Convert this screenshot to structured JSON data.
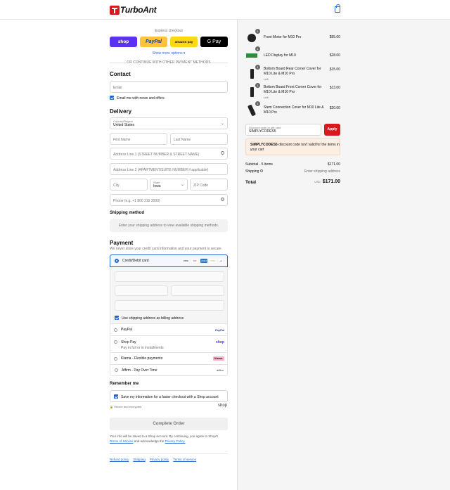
{
  "brand": {
    "name": "TurboAnt"
  },
  "express": {
    "title": "Express checkout",
    "buttons": [
      "shop",
      "PayPal",
      "amazon pay",
      "G Pay"
    ],
    "more": "Show more options",
    "divider": "OR CONTINUE WITH OTHER PAYMENT METHODS"
  },
  "contact": {
    "heading": "Contact",
    "email_placeholder": "Email",
    "news_label": "Email me with news and offers"
  },
  "delivery": {
    "heading": "Delivery",
    "country_label": "Country/Region",
    "country_value": "United States",
    "first_name": "First Name",
    "last_name": "Last Name",
    "address1": "Address Line 1 (STREET NUMBER & STREET NAME)",
    "address2": "Address Line 2 (APARTMENT/SUITE NUMBER if applicable)",
    "city": "City",
    "state_label": "State",
    "state_value": "Iowa",
    "zip": "ZIP Code",
    "phone": "Phone (e.g. +1 800 319 3000)"
  },
  "shipping": {
    "heading": "Shipping method",
    "note": "Enter your shipping address to view available shipping methods."
  },
  "payment": {
    "heading": "Payment",
    "sub": "We never store your credit card information and your payment is secure.",
    "card_label": "Credit/Debit card",
    "card_logos": [
      "VISA",
      "MC",
      "AMEX",
      "DISC",
      "+4"
    ],
    "billing_same": "Use shipping address as billing address",
    "methods": [
      {
        "label": "PayPal",
        "sub": "",
        "logo": "PayPal"
      },
      {
        "label": "Shop Pay",
        "sub": "Pay in full or in installments",
        "logo": "shop"
      },
      {
        "label": "Klarna - Flexible payments",
        "sub": "",
        "logo": "Klarna."
      },
      {
        "label": "Affirm - Pay Over Time",
        "sub": "",
        "logo": "affirm"
      }
    ]
  },
  "remember": {
    "heading": "Remember me",
    "save_label": "Save my information for a faster checkout with a Shop account",
    "secure": "Secure and encrypted",
    "shop_logo": "shop"
  },
  "complete": {
    "button": "Complete Order",
    "legal_1": "Your info will be saved to a Shop account. By continuing, you agree to Shop's",
    "terms_link": "Terms of Service",
    "legal_2": "and acknowledge the",
    "privacy_link": "Privacy Policy."
  },
  "footer": {
    "links": [
      "Refund policy",
      "Shipping",
      "Privacy policy",
      "Terms of service"
    ]
  },
  "cart": {
    "items": [
      {
        "name": "Front Motor for M10 Pro",
        "variant": "",
        "qty": "1",
        "price": "$95.00"
      },
      {
        "name": "LED Display for M10",
        "variant": "",
        "qty": "1",
        "price": "$28.00"
      },
      {
        "name": "Bottom Board Rear Corner Cover for M10 Lite & M10 Pro",
        "variant": "Left",
        "qty": "1",
        "price": "$15.00"
      },
      {
        "name": "Bottom Board Front Corner Cover for M10 Lite & M10 Pro",
        "variant": "Left",
        "qty": "1",
        "price": "$13.00"
      },
      {
        "name": "Stem Connection Cover for M10 Lite & M10 Pro",
        "variant": "",
        "qty": "1",
        "price": "$20.00"
      }
    ],
    "discount_label": "Discount code or gift card",
    "discount_value": "SIMPLYCODES5",
    "apply": "Apply",
    "error_code": "SIMPLYCODES5",
    "error_text": "discount code isn't valid for the items in your cart",
    "subtotal_label": "Subtotal · 5 items",
    "subtotal_value": "$171.00",
    "shipping_label": "Shipping",
    "shipping_value": "Enter shipping address",
    "total_label": "Total",
    "currency": "USD",
    "total_value": "$171.00"
  },
  "colors": {
    "accent": "#1c66d6",
    "apply": "#d71920",
    "shop": "#5a31f4",
    "paypal": "#ffc439"
  }
}
